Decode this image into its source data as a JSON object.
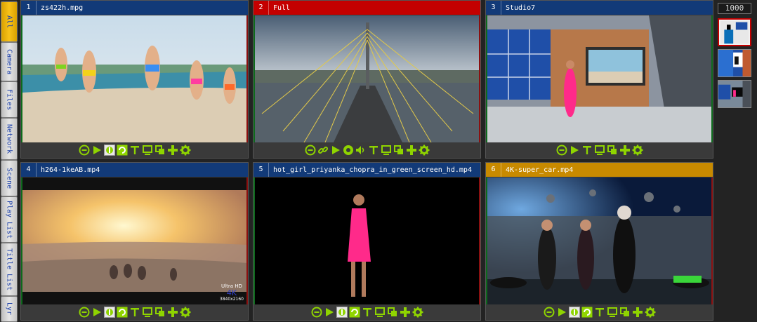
{
  "tabs": [
    {
      "label": "All",
      "active": true
    },
    {
      "label": "Camera",
      "active": false
    },
    {
      "label": "Files",
      "active": false
    },
    {
      "label": "Network",
      "active": false
    },
    {
      "label": "Scene",
      "active": false
    },
    {
      "label": "Play List",
      "active": false
    },
    {
      "label": "Title List",
      "active": false
    },
    {
      "label": "Lyr",
      "active": false
    }
  ],
  "panels": [
    {
      "num": "1",
      "name": "zs422h.mpg",
      "header_color": "#123a78"
    },
    {
      "num": "2",
      "name": "Full",
      "header_color": "#c40000"
    },
    {
      "num": "3",
      "name": "Studio7",
      "header_color": "#123a78"
    },
    {
      "num": "4",
      "name": "h264-1keAB.mp4",
      "header_color": "#123a78"
    },
    {
      "num": "5",
      "name": "hot_girl_priyanka_chopra_in_green_screen_hd.mp4",
      "header_color": "#123a78"
    },
    {
      "num": "6",
      "name": "4K-super_car.mp4",
      "header_color": "#c88a00"
    }
  ],
  "overlay": {
    "line1": "Ultra HD",
    "line2": "4K",
    "line3": "3840x2160"
  },
  "counter": "1000",
  "icons": {
    "file": [
      "stop-icon",
      "play-icon",
      "loop-once-icon",
      "loop-icon",
      "text-icon",
      "monitor-icon",
      "copy-icon",
      "add-icon",
      "settings-icon"
    ],
    "network": [
      "stop-icon",
      "link-icon",
      "play-icon",
      "record-icon",
      "audio-icon",
      "text-icon",
      "monitor-icon",
      "copy-icon",
      "add-icon",
      "settings-icon"
    ],
    "scene": [
      "stop-icon",
      "play-icon",
      "text-icon",
      "monitor-icon",
      "copy-icon",
      "add-icon",
      "settings-icon"
    ]
  },
  "colors": {
    "accent_green": "#8fd400",
    "header_blue": "#123a78",
    "header_red": "#c40000",
    "header_gold": "#c88a00"
  }
}
